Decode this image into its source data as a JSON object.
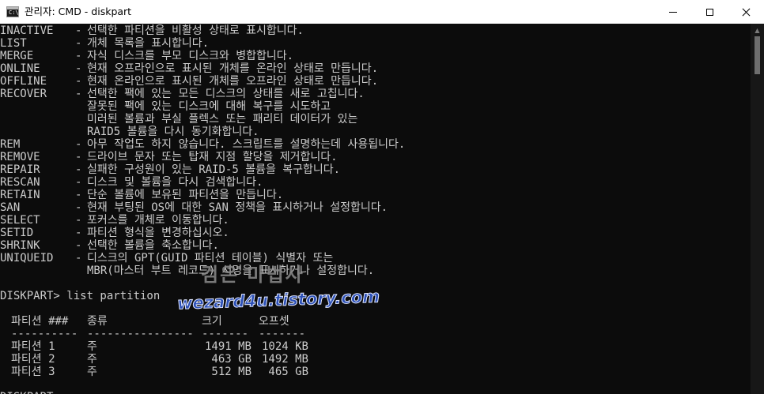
{
  "window": {
    "title": "관리자: CMD - diskpart",
    "icon_label": "C:\\",
    "icon": "cmd-terminal-icon",
    "controls": [
      "minimize-icon",
      "maximize-icon",
      "close-icon"
    ]
  },
  "help_entries": [
    {
      "cmd": "INACTIVE",
      "lines": [
        "선택한 파티션을 비활성 상태로 표시합니다."
      ]
    },
    {
      "cmd": "LIST",
      "lines": [
        "개체 목록을 표시합니다."
      ]
    },
    {
      "cmd": "MERGE",
      "lines": [
        "자식 디스크를 부모 디스크와 병합합니다."
      ]
    },
    {
      "cmd": "ONLINE",
      "lines": [
        "현재 오프라인으로 표시된 개체를 온라인 상태로 만듭니다."
      ]
    },
    {
      "cmd": "OFFLINE",
      "lines": [
        "현재 온라인으로 표시된 개체를 오프라인 상태로 만듭니다."
      ]
    },
    {
      "cmd": "RECOVER",
      "lines": [
        "선택한 팩에 있는 모든 디스크의 상태를 새로 고칩니다.",
        "잘못된 팩에 있는 디스크에 대해 복구를 시도하고",
        "미러된 볼륨과 부실 플렉스 또는 패리티 데이터가 있는",
        "RAID5 볼륨을 다시 동기화합니다."
      ]
    },
    {
      "cmd": "REM",
      "lines": [
        "아무 작업도 하지 않습니다. 스크립트를 설명하는데 사용됩니다."
      ]
    },
    {
      "cmd": "REMOVE",
      "lines": [
        "드라이브 문자 또는 탑재 지점 할당을 제거합니다."
      ]
    },
    {
      "cmd": "REPAIR",
      "lines": [
        "실패한 구성원이 있는 RAID-5 볼륨을 복구합니다."
      ]
    },
    {
      "cmd": "RESCAN",
      "lines": [
        "디스크 및 볼륨을 다시 검색합니다."
      ]
    },
    {
      "cmd": "RETAIN",
      "lines": [
        "단순 볼륨에 보유된 파티션을 만듭니다."
      ]
    },
    {
      "cmd": "SAN",
      "lines": [
        "현재 부팅된 OS에 대한 SAN 정책을 표시하거나 설정합니다."
      ]
    },
    {
      "cmd": "SELECT",
      "lines": [
        "포커스를 개체로 이동합니다."
      ]
    },
    {
      "cmd": "SETID",
      "lines": [
        "파티션 형식을 변경하십시오."
      ]
    },
    {
      "cmd": "SHRINK",
      "lines": [
        "선택한 볼륨을 축소합니다."
      ]
    },
    {
      "cmd": "UNIQUEID",
      "lines": [
        "디스크의 GPT(GUID 파티션 테이블) 식별자 또는",
        "MBR(마스터 부트 레코드) 서명을 표시하거나 설정합니다."
      ]
    }
  ],
  "dash": "-",
  "prompt_command": "DISKPART> list partition",
  "partition_table": {
    "headers": [
      "파티션 ###",
      "종류",
      "크기",
      "오프셋"
    ],
    "separators": [
      "----------",
      "----------------",
      "-------",
      "-------"
    ],
    "rows": [
      [
        "파티션 1",
        "주",
        "1491 MB",
        "1024 KB"
      ],
      [
        "파티션 2",
        "주",
        "463 GB",
        "1492 MB"
      ],
      [
        "파티션 3",
        "주",
        "512 MB",
        "465 GB"
      ]
    ]
  },
  "final_prompt": "DISKPART>",
  "watermark": {
    "korean": "검은 마법사",
    "url": "wezard4u.tistory.com",
    "blue": "#2b4fb6"
  },
  "colors": {
    "console_bg": "#0c0c0c",
    "console_text": "#cccccc",
    "titlebar_bg": "#ffffff"
  }
}
